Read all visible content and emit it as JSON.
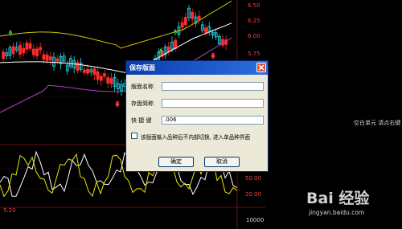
{
  "axis_right": {
    "top_labels": [
      "6.50",
      "6.25",
      "6.00",
      "5.75"
    ],
    "bottom_labels": [
      "50.00",
      "20.00"
    ],
    "bottom_volume_label": "10000",
    "lower_left_value": "5.20"
  },
  "side_note": "空白单元 请点右键",
  "dialog": {
    "title": "保存版面",
    "fields": [
      {
        "label": "版面名称",
        "value": ""
      },
      {
        "label": "存盘简称",
        "value": ""
      },
      {
        "label": "快 捷 键",
        "value": ".006"
      }
    ],
    "checkbox": {
      "checked": false,
      "label": "该版面输入品种后不内部切换, 进入单品种界面"
    },
    "ok_label": "确定",
    "cancel_label": "取消"
  },
  "watermark": {
    "logo_text": "Bai 经验",
    "url": "jingyan.baidu.com"
  },
  "colors": {
    "background": "#000000",
    "bull_candle": "#2ad6e6",
    "bear_candle": "#ff2a2a",
    "upper_band": "#c9c900",
    "ma_white": "#ffffff",
    "ma_purple": "#b040c8",
    "grid_red": "#8a1010",
    "dialog_face": "#ece9d8",
    "titlebar": "#0a3cae"
  },
  "icons": [
    "close-icon",
    "buy-arrow-icon",
    "sell-arrow-icon"
  ]
}
